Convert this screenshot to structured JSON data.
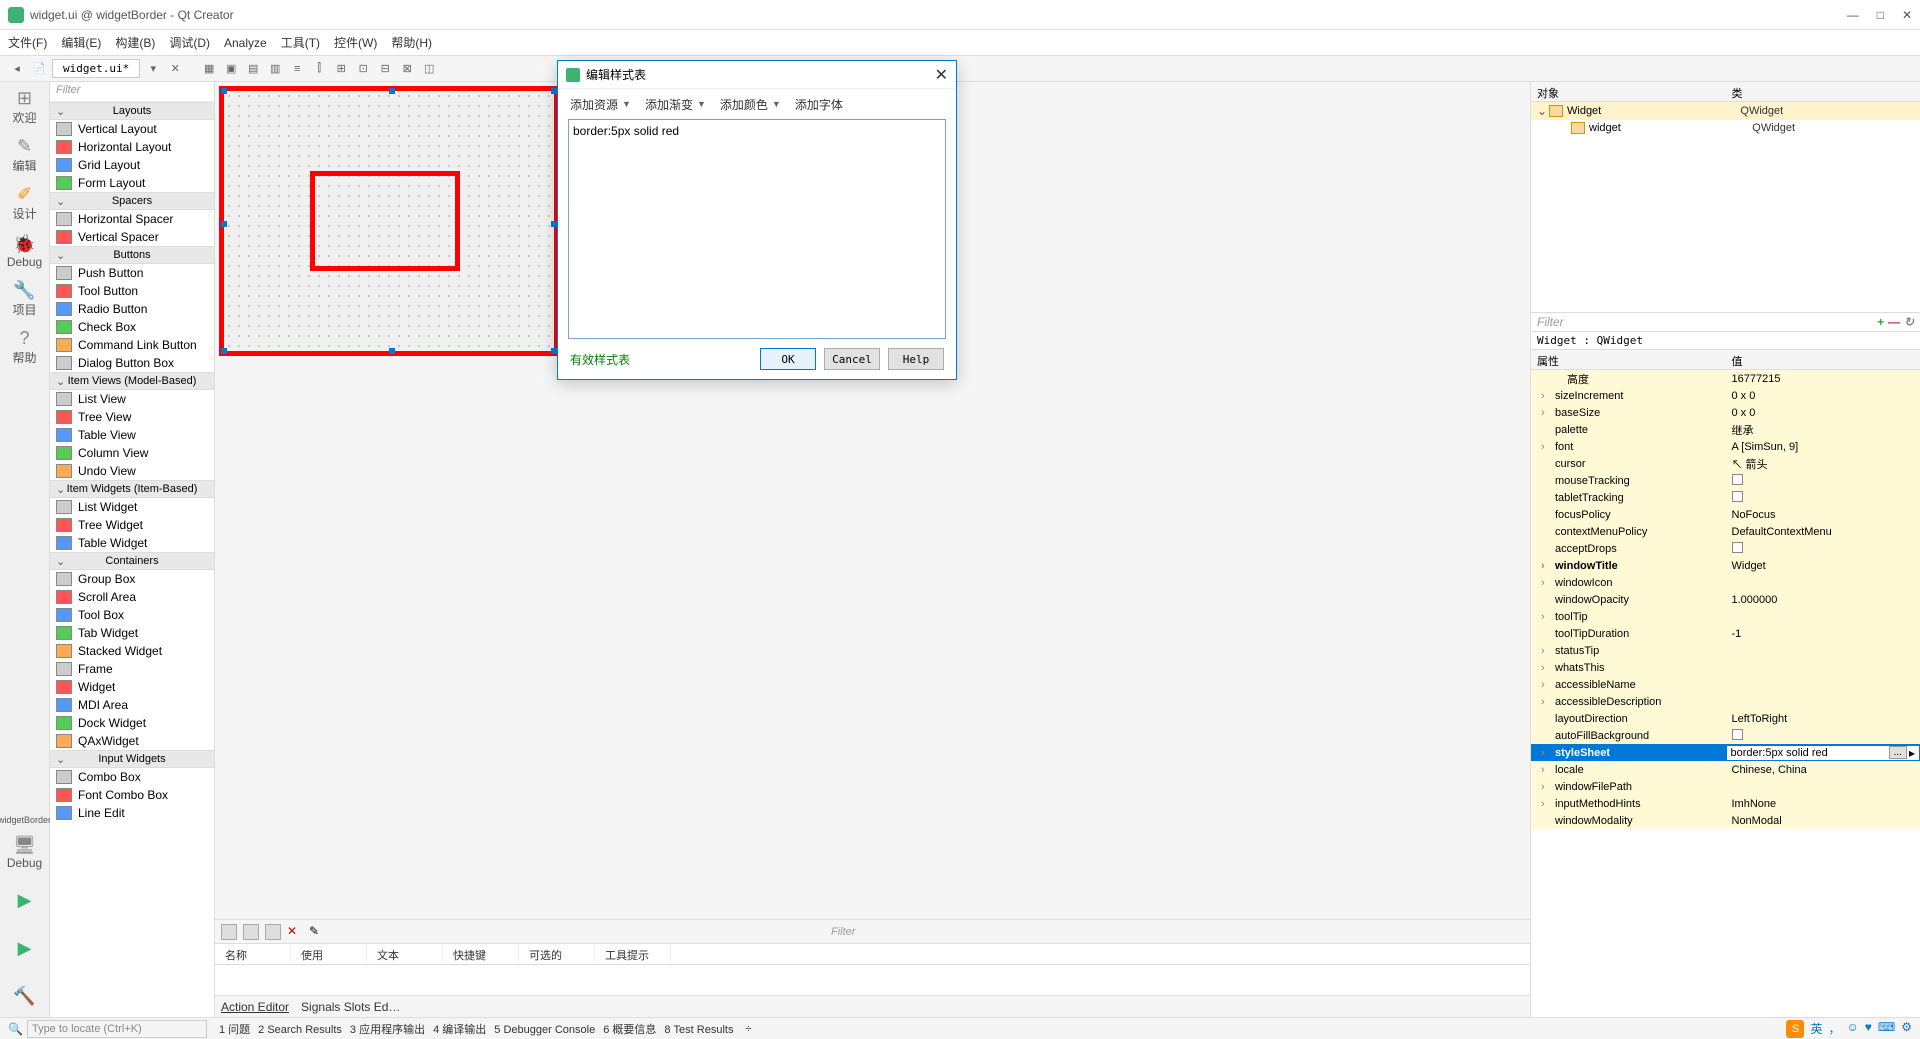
{
  "window": {
    "title": "widget.ui @ widgetBorder - Qt Creator",
    "min": "—",
    "max": "□",
    "close": "✕"
  },
  "menu": [
    "文件(F)",
    "编辑(E)",
    "构建(B)",
    "调试(D)",
    "Analyze",
    "工具(T)",
    "控件(W)",
    "帮助(H)"
  ],
  "tab": {
    "name": "widget.ui*"
  },
  "modes": [
    {
      "icon": "⊞",
      "label": "欢迎"
    },
    {
      "icon": "✎",
      "label": "编辑"
    },
    {
      "icon": "✐",
      "label": "设计",
      "active": true
    },
    {
      "icon": "🐞",
      "label": "Debug"
    },
    {
      "icon": "🔧",
      "label": "项目"
    },
    {
      "icon": "?",
      "label": "帮助"
    }
  ],
  "modebar_extra": {
    "project": "widgetBorder",
    "debug": "Debug"
  },
  "filter_placeholder": "Filter",
  "widgetbox": [
    {
      "cat": "Layouts",
      "items": [
        "Vertical Layout",
        "Horizontal Layout",
        "Grid Layout",
        "Form Layout"
      ]
    },
    {
      "cat": "Spacers",
      "items": [
        "Horizontal Spacer",
        "Vertical Spacer"
      ]
    },
    {
      "cat": "Buttons",
      "items": [
        "Push Button",
        "Tool Button",
        "Radio Button",
        "Check Box",
        "Command Link Button",
        "Dialog Button Box"
      ]
    },
    {
      "cat": "Item Views (Model-Based)",
      "items": [
        "List View",
        "Tree View",
        "Table View",
        "Column View",
        "Undo View"
      ]
    },
    {
      "cat": "Item Widgets (Item-Based)",
      "items": [
        "List Widget",
        "Tree Widget",
        "Table Widget"
      ]
    },
    {
      "cat": "Containers",
      "items": [
        "Group Box",
        "Scroll Area",
        "Tool Box",
        "Tab Widget",
        "Stacked Widget",
        "Frame",
        "Widget",
        "MDI Area",
        "Dock Widget",
        "QAxWidget"
      ]
    },
    {
      "cat": "Input Widgets",
      "items": [
        "Combo Box",
        "Font Combo Box",
        "Line Edit"
      ]
    }
  ],
  "action_headers": [
    "名称",
    "使用",
    "文本",
    "快捷键",
    "可选的",
    "工具提示"
  ],
  "action_tabs": [
    "Action Editor",
    "Signals  Slots Ed…"
  ],
  "action_filter": "Filter",
  "object_head": {
    "obj": "对象",
    "cls": "类"
  },
  "objects": [
    {
      "name": "Widget",
      "cls": "QWidget",
      "top": true,
      "sel": true
    },
    {
      "name": "widget",
      "cls": "QWidget",
      "top": false
    }
  ],
  "prop_class_line": "Widget : QWidget",
  "prop_head": {
    "n": "属性",
    "v": "值"
  },
  "props": [
    {
      "n": "高度",
      "v": "16777215",
      "ind": true
    },
    {
      "n": "sizeIncrement",
      "v": "0 x 0",
      "exp": true
    },
    {
      "n": "baseSize",
      "v": "0 x 0",
      "exp": true
    },
    {
      "n": "palette",
      "v": "继承"
    },
    {
      "n": "font",
      "v": "A  [SimSun, 9]",
      "exp": true
    },
    {
      "n": "cursor",
      "v": "↖ 箭头"
    },
    {
      "n": "mouseTracking",
      "v": "",
      "chk": true
    },
    {
      "n": "tabletTracking",
      "v": "",
      "chk": true
    },
    {
      "n": "focusPolicy",
      "v": "NoFocus"
    },
    {
      "n": "contextMenuPolicy",
      "v": "DefaultContextMenu"
    },
    {
      "n": "acceptDrops",
      "v": "",
      "chk": true
    },
    {
      "n": "windowTitle",
      "v": "Widget",
      "exp": true,
      "b": true
    },
    {
      "n": "windowIcon",
      "v": "",
      "exp": true
    },
    {
      "n": "windowOpacity",
      "v": "1.000000"
    },
    {
      "n": "toolTip",
      "v": "",
      "exp": true
    },
    {
      "n": "toolTipDuration",
      "v": "-1"
    },
    {
      "n": "statusTip",
      "v": "",
      "exp": true
    },
    {
      "n": "whatsThis",
      "v": "",
      "exp": true
    },
    {
      "n": "accessibleName",
      "v": "",
      "exp": true
    },
    {
      "n": "accessibleDescription",
      "v": "",
      "exp": true
    },
    {
      "n": "layoutDirection",
      "v": "LeftToRight"
    },
    {
      "n": "autoFillBackground",
      "v": "",
      "chk": true
    },
    {
      "n": "styleSheet",
      "v": "border:5px solid red",
      "exp": true,
      "sel": true,
      "b": true
    },
    {
      "n": "locale",
      "v": "Chinese, China",
      "exp": true
    },
    {
      "n": "windowFilePath",
      "v": "",
      "exp": true
    },
    {
      "n": "inputMethodHints",
      "v": "ImhNone",
      "exp": true
    },
    {
      "n": "windowModality",
      "v": "NonModal"
    }
  ],
  "dialog": {
    "title": "编辑样式表",
    "toolbar": [
      "添加资源",
      "添加渐变",
      "添加颜色",
      "添加字体"
    ],
    "content": "border:5px solid red",
    "valid": "有效样式表",
    "ok": "OK",
    "cancel": "Cancel",
    "help": "Help"
  },
  "statusbar": {
    "search": "Type to locate (Ctrl+K)",
    "items": [
      "1 问题",
      "2 Search Results",
      "3 应用程序输出",
      "4 编译输出",
      "5 Debugger Console",
      "6 概要信息",
      "8 Test Results"
    ],
    "ime": "S",
    "lang": "英"
  }
}
